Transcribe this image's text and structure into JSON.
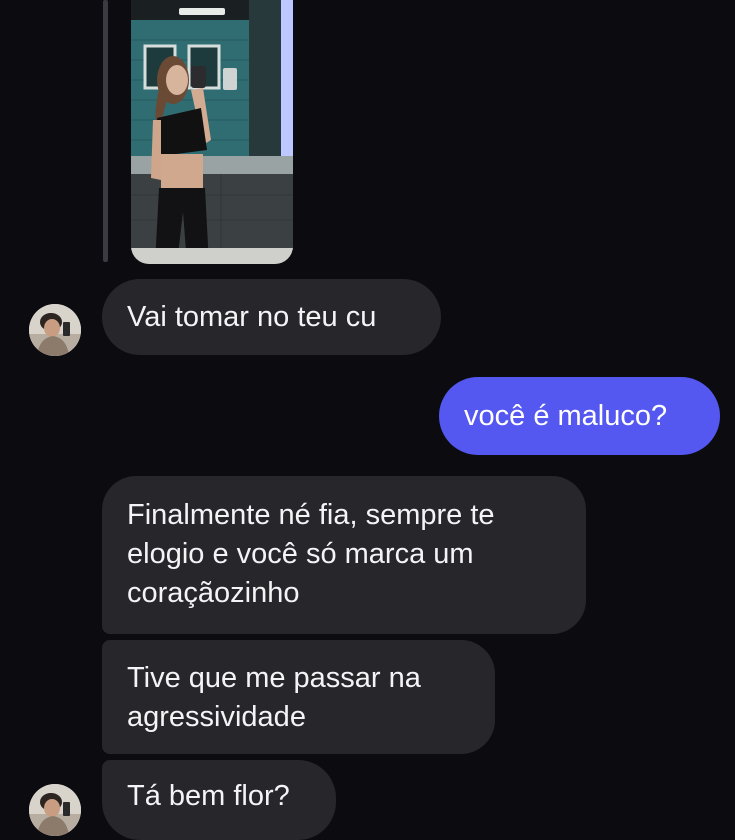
{
  "messages": [
    {
      "side": "incoming",
      "text": "Vai tomar no teu cu"
    },
    {
      "side": "outgoing",
      "text": "você é maluco?"
    },
    {
      "side": "incoming",
      "lines": [
        "Finalmente né fia, sempre te",
        "elogio e você só marca um",
        "coraçãozinho"
      ]
    },
    {
      "side": "incoming",
      "lines": [
        "Tive que me passar na",
        "agressividade"
      ]
    },
    {
      "side": "incoming",
      "text": "Tá bem flor?"
    }
  ],
  "colors": {
    "background": "#0c0c10",
    "incoming_bubble": "#26262b",
    "outgoing_bubble": "#5458f0",
    "text": "#f4f4f6"
  },
  "icons": {
    "avatar": "contact-avatar",
    "photo": "shared-photo"
  }
}
